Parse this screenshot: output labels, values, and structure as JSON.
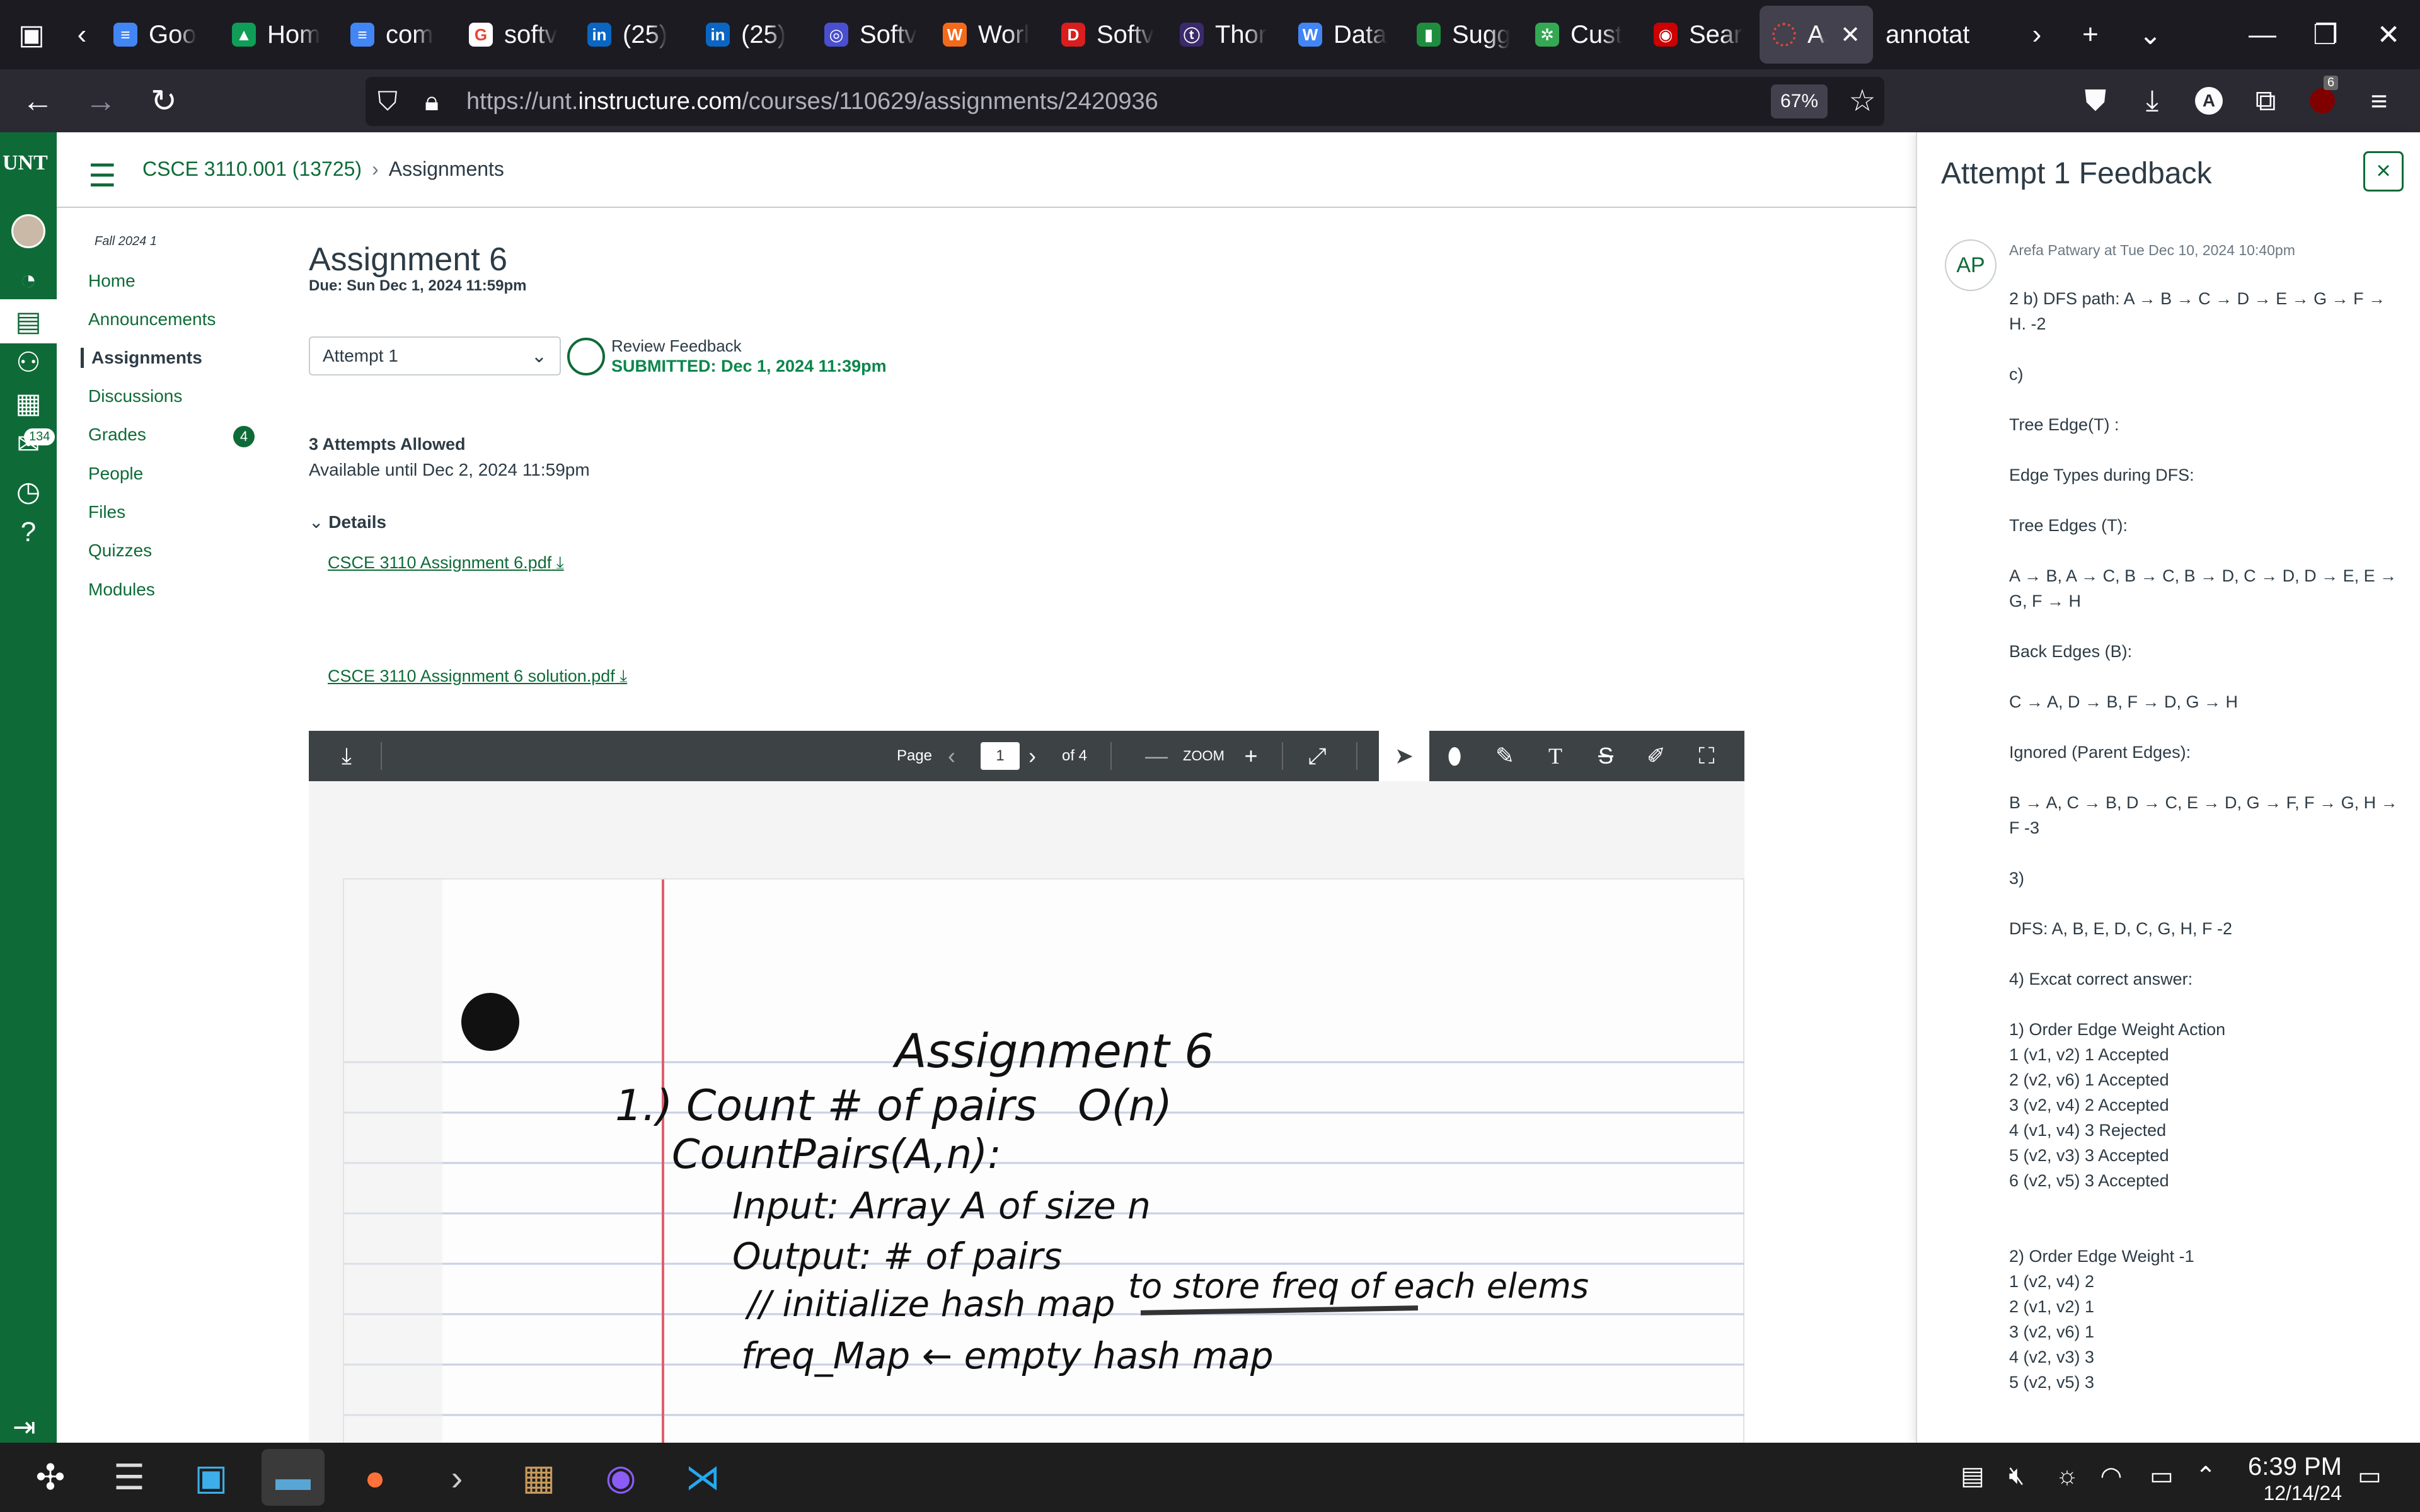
{
  "browser": {
    "tabs": [
      {
        "label": "Goo",
        "fav": "docs",
        "color": "#4285f4"
      },
      {
        "label": "Hom",
        "fav": "drive",
        "color": "#0f9d58"
      },
      {
        "label": "com",
        "fav": "docs",
        "color": "#4285f4"
      },
      {
        "label": "softv",
        "fav": "google",
        "color": "#ffffff"
      },
      {
        "label": "(25)",
        "fav": "linkedin",
        "color": "#0a66c2"
      },
      {
        "label": "(25)",
        "fav": "linkedin",
        "color": "#0a66c2"
      },
      {
        "label": "Softv",
        "fav": "globe",
        "color": "#4a4fcf"
      },
      {
        "label": "Worl",
        "fav": "w",
        "color": "#f26a1b"
      },
      {
        "label": "Softv",
        "fav": "d",
        "color": "#d81e1e"
      },
      {
        "label": "Thor",
        "fav": "thor",
        "color": "#3b2a6b"
      },
      {
        "label": "Data",
        "fav": "w",
        "color": "#4285f4"
      },
      {
        "label": "Sugg",
        "fav": "pin",
        "color": "#1e8e3e"
      },
      {
        "label": "Cust",
        "fav": "cust",
        "color": "#34a853"
      },
      {
        "label": "Sear",
        "fav": "target",
        "color": "#cc0000"
      }
    ],
    "active_tab": {
      "label": "As"
    },
    "plain_tab": {
      "label": "annotat"
    },
    "url_prefix": "https://unt.",
    "url_domain": "instructure.com",
    "url_path": "/courses/110629/assignments/2420936",
    "zoom": "67%",
    "ext_badge": "6"
  },
  "canvas_nav": {
    "logo": "UNT",
    "inbox_count": "134"
  },
  "breadcrumb": {
    "course": "CSCE 3110.001 (13725)",
    "sep": "›",
    "page": "Assignments"
  },
  "course_nav": {
    "term": "Fall 2024 1",
    "items": [
      "Home",
      "Announcements",
      "Assignments",
      "Discussions",
      "Grades",
      "People",
      "Files",
      "Quizzes",
      "Modules"
    ],
    "grades_badge": "4"
  },
  "assignment": {
    "title": "Assignment 6",
    "due": "Due: Sun Dec 1, 2024 11:59pm",
    "attempt_select": "Attempt 1",
    "review_label": "Review Feedback",
    "submitted": "SUBMITTED: Dec 1, 2024 11:39pm",
    "attempts_allowed": "3 Attempts Allowed",
    "available": "Available until Dec 2, 2024 11:59pm",
    "details_label": "Details",
    "files": [
      "CSCE 3110 Assignment 6.pdf",
      "CSCE 3110 Assignment 6 solution.pdf"
    ]
  },
  "pdf": {
    "page_label": "Page",
    "page_current": "1",
    "page_total": "of 4",
    "zoom_label": "ZOOM",
    "handwriting": {
      "title": "Assignment 6",
      "line1": "1.) Count # of pairs   O(n)",
      "line2": "CountPairs(A,n):",
      "line3": "Input: Array A of size n",
      "line4": "Output: # of pairs",
      "line5": "// initialize hash map",
      "line5_note": "to store freq of each elems",
      "line6": "freq_Map ← empty hash map"
    }
  },
  "feedback": {
    "title": "Attempt 1 Feedback",
    "close": "×",
    "avatar": "AP",
    "meta": "Arefa Patwary at Tue Dec 10, 2024 10:40pm",
    "paragraphs": [
      "2 b)  DFS path:  A → B → C → D → E → G → F → H.  -2",
      "c)",
      "Tree Edge(T) :",
      "Edge Types during DFS:",
      "Tree Edges (T):",
      "A → B, A → C, B → C, B → D, C → D, D → E, E → G, F → H",
      "Back Edges (B):",
      "C → A, D → B, F → D, G → H",
      "Ignored (Parent Edges):",
      "B → A, C → B, D → C, E → D, G → F, F → G, H → F -3",
      "3)",
      "DFS: A, B, E, D, C, G, H, F -2",
      "4) Excat correct answer:",
      "1) Order Edge Weight Action\n1 (v1, v2) 1 Accepted\n2 (v2, v6) 1 Accepted\n3 (v2, v4) 2 Accepted\n4 (v1, v4) 3 Rejected\n5 (v2, v3) 3 Accepted\n6 (v2, v5) 3 Accepted\n\n",
      "2) Order Edge Weight   -1\n1 (v2, v4) 2\n2 (v1, v2) 1\n3 (v2, v6) 1\n4 (v2, v3) 3\n5 (v2, v5) 3"
    ]
  },
  "taskbar": {
    "time": "6:39 PM",
    "date": "12/14/24"
  }
}
